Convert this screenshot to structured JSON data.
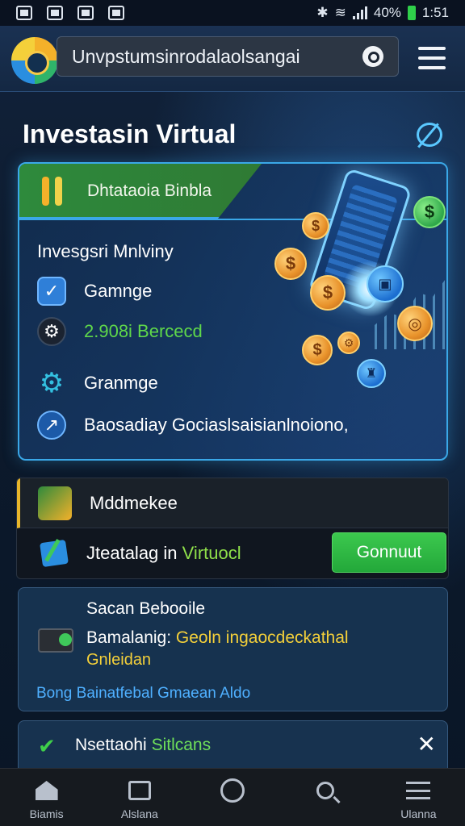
{
  "status_bar": {
    "battery": "40%",
    "time": "1:51",
    "battery_color": "#2fd04a"
  },
  "header": {
    "search_text": "Unvpstumsinrodalaolsangai",
    "logo": "app-logo",
    "search_button_icon": "search-icon",
    "menu_icon": "hamburger-icon"
  },
  "page": {
    "title": "Investasin Virtual"
  },
  "hero": {
    "banner_label": "Dhtataoia Binbla",
    "subtitle": "Invesgsri Mnlviny",
    "rows": [
      {
        "icon": "checkbox-icon",
        "text": "Gamnge"
      },
      {
        "icon": "gear-icon",
        "text": "2.908i Bercecd",
        "color": "#5fd84a"
      },
      {
        "icon": "cog-icon",
        "text": "Granmge"
      },
      {
        "icon": "compass-icon",
        "text": "Baosadiay Gociaslsaisianlnoiono,"
      }
    ]
  },
  "card2": {
    "title": "Mddmekee",
    "text_prefix": "Jteatalag in",
    "text_highlight": "Virtuocl",
    "button_label": "Gonnuut",
    "accent": "#e8b62a"
  },
  "card3": {
    "title": "Sacan Bebooile",
    "line1_prefix": "Bamalanig:",
    "line1_highlight": "Geoln ingaocdeckathal",
    "line2": "Gnleidan",
    "link": "Bong Bainatfebal Gmaean Aldo"
  },
  "card4": {
    "title_prefix": "Nsettaohi",
    "title_highlight": "Sitlcans"
  },
  "bottom_nav": [
    {
      "icon": "home-icon",
      "label": "Biamis"
    },
    {
      "icon": "edit-icon",
      "label": "Alslana"
    },
    {
      "icon": "circle-icon",
      "label": ""
    },
    {
      "icon": "search-icon",
      "label": ""
    },
    {
      "icon": "menu-icon",
      "label": "Ulanna"
    }
  ]
}
